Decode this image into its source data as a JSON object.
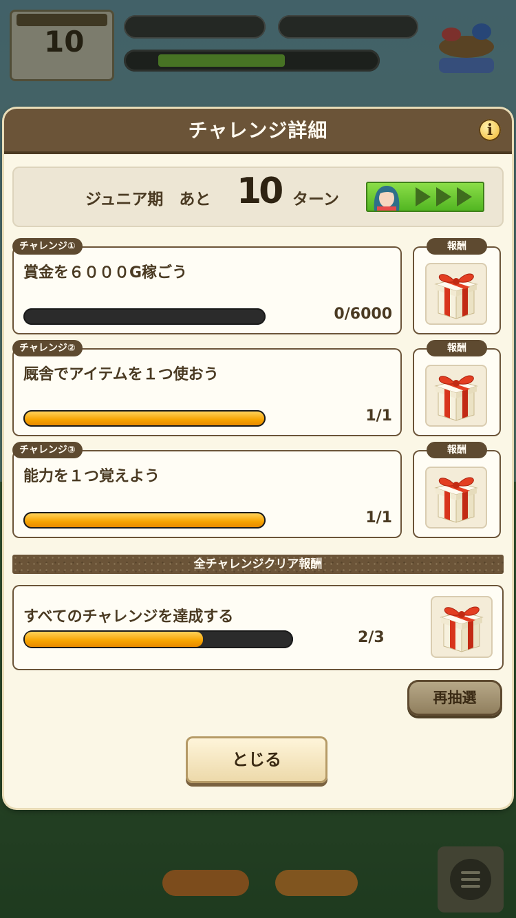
{
  "dialog": {
    "title": "チャレンジ詳細",
    "info_icon": "i"
  },
  "turn": {
    "label": "ジュニア期　あと",
    "number": "10",
    "unit": "ターン"
  },
  "challenges": [
    {
      "tag": "チャレンジ①",
      "text": "賞金を６０００G稼ごう",
      "progress": "0/6000",
      "fraction": 0.0,
      "reward_label": "報酬"
    },
    {
      "tag": "チャレンジ②",
      "text": "厩舎でアイテムを１つ使おう",
      "progress": "1/1",
      "fraction": 1.0,
      "reward_label": "報酬"
    },
    {
      "tag": "チャレンジ③",
      "text": "能力を１つ覚えよう",
      "progress": "1/1",
      "fraction": 1.0,
      "reward_label": "報酬"
    }
  ],
  "all_clear": {
    "header": "全チャレンジクリア報酬",
    "text": "すべてのチャレンジを達成する",
    "progress": "2/3",
    "fraction": 0.6667
  },
  "buttons": {
    "redraw": "再抽選",
    "close": "とじる"
  },
  "icons": {
    "info": "info-icon",
    "reward": "gift-box-icon",
    "gauge_arrow": "chevron-right-icon",
    "portrait": "character-portrait-icon"
  },
  "colors": {
    "header_brown": "#6b5438",
    "progress_orange": "#f7a300",
    "gauge_green": "#79c23a",
    "gift_red": "#d8341c"
  },
  "background": {
    "turn_card_number": "10"
  }
}
